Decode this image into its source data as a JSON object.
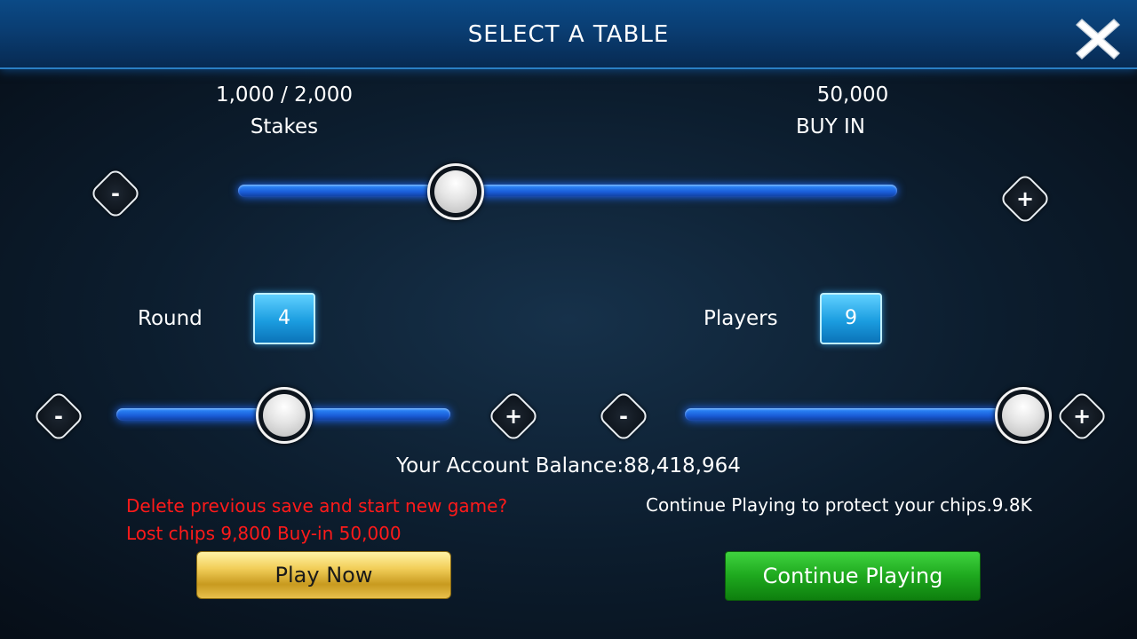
{
  "header": {
    "title": "SELECT A TABLE",
    "close_icon": "close-x-icon"
  },
  "stakes": {
    "value": "1,000 / 2,000",
    "label": "Stakes"
  },
  "buy_in": {
    "value": "50,000",
    "label": "BUY IN"
  },
  "sliders": {
    "stakes": {
      "level": 0.33
    },
    "round": {
      "level": 0.5
    },
    "players": {
      "level": 1.0
    }
  },
  "round": {
    "label": "Round",
    "value": "4"
  },
  "players": {
    "label": "Players",
    "value": "9"
  },
  "buttons": {
    "minus": "-",
    "plus": "+"
  },
  "balance": "Your Account Balance:88,418,964",
  "warning": {
    "line1": "Delete previous save and start new game?",
    "line2": "Lost chips 9,800 Buy-in 50,000"
  },
  "continue_note": "Continue Playing to protect your chips.9.8K",
  "actions": {
    "play_now": "Play Now",
    "continue_playing": "Continue Playing"
  },
  "colors": {
    "accent_blue": "#1f6cff",
    "warning_red": "#ff1a1a",
    "play_gold": "#f2cf5a",
    "continue_green": "#1ea81e"
  }
}
